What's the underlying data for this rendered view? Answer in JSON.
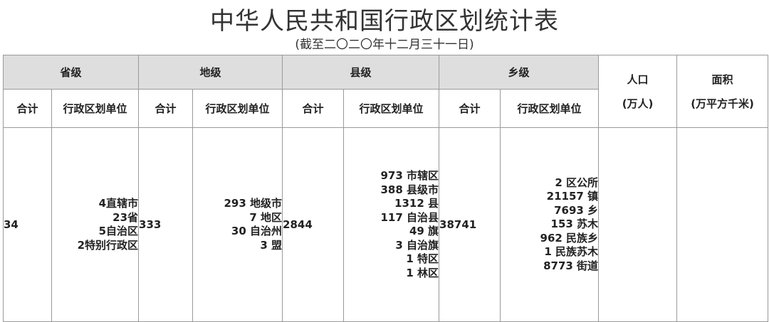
{
  "title": "中华人民共和国行政区划统计表",
  "subtitle": "(截至二〇二〇年十二月三十一日)",
  "headers": {
    "province": "省级",
    "prefecture": "地级",
    "county": "县级",
    "township": "乡级",
    "population_line1": "人口",
    "population_line2": "(万人)",
    "area_line1": "面积",
    "area_line2": "(万平方千米)",
    "total": "合计",
    "units": "行政区划单位"
  },
  "province": {
    "total": "34",
    "units": [
      "4直辖市",
      "23省",
      "5自治区",
      "2特别行政区"
    ]
  },
  "prefecture": {
    "total": "333",
    "units": [
      "293 地级市",
      "7 地区",
      "30 自治州",
      "3 盟"
    ]
  },
  "county": {
    "total": "2844",
    "units": [
      "973 市辖区",
      "388 县级市",
      "1312 县",
      "117 自治县",
      "49 旗",
      "3 自治旗",
      "1 特区",
      "1 林区"
    ]
  },
  "township": {
    "total": "38741",
    "units": [
      "2 区公所",
      "21157 镇",
      "7693 乡",
      "153 苏木",
      "962 民族乡",
      "1 民族苏木",
      "8773 街道"
    ]
  },
  "population": "",
  "area": ""
}
